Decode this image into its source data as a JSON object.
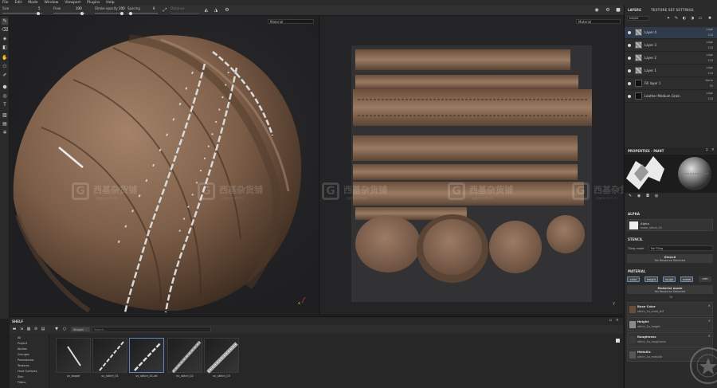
{
  "menu": [
    "File",
    "Edit",
    "Mode",
    "Window",
    "Viewport",
    "Plugins",
    "Help"
  ],
  "toolbar": {
    "size_label": "Size",
    "size_value": "5",
    "flow_label": "Flow",
    "flow_value": "100",
    "stroke_opacity_label": "Stroke opacity",
    "stroke_opacity_value": "100",
    "spacing_label": "Spacing",
    "spacing_value": "6",
    "distance_label": "Distance"
  },
  "viewport": {
    "left_dropdown": "Material",
    "right_dropdown": "Material"
  },
  "watermark": {
    "text": "西基杂货铺",
    "sub": "cgpro.com.cn"
  },
  "layers_panel": {
    "tab_layers": "LAYERS",
    "tab_texture_set": "TEXTURE SET SETTINGS",
    "channel": "height",
    "layers": [
      {
        "name": "Layer 4",
        "blend": "Ldge",
        "opacity": "100"
      },
      {
        "name": "Layer 3",
        "blend": "Ldge",
        "opacity": "100"
      },
      {
        "name": "Layer 2",
        "blend": "Ldge",
        "opacity": "100"
      },
      {
        "name": "Layer 1",
        "blend": "Ldge",
        "opacity": "100"
      },
      {
        "name": "Fill layer 1",
        "blend": "Norm",
        "opacity": "35"
      },
      {
        "name": "Leather Medium Grain",
        "blend": "Ldge",
        "opacity": "100"
      }
    ]
  },
  "properties": {
    "header": "PROPERTIES - PAINT",
    "alpha_section": "ALPHA",
    "alpha_name": "Alpha",
    "alpha_value": "mask_stitch_01",
    "stencil_section": "STENCIL",
    "tiling_label": "Tiling mode",
    "tiling_value": "No Tiling",
    "stencil_title": "Stencil",
    "stencil_value": "No Resource Selected",
    "material_section": "MATERIAL",
    "channels": [
      "color",
      "height",
      "rough",
      "metal",
      "nrm"
    ],
    "material_mode_title": "Material mode",
    "material_mode_value": "No Resource Selected",
    "or": "Or",
    "slots": [
      {
        "title": "Base Color",
        "value": "stitch_1a_color_ALT"
      },
      {
        "title": "Height",
        "value": "stitch_1a_height"
      },
      {
        "title": "Roughness",
        "value": "stitch_1a_roughness"
      },
      {
        "title": "Metallic",
        "value": "stitch_1a_metallic"
      }
    ]
  },
  "shelf": {
    "title": "SHELF",
    "filter_tag": "Shapes",
    "search_placeholder": "Search...",
    "categories": [
      "All",
      "Project",
      "Alphas",
      "Grunges",
      "Procedurals",
      "Textures",
      "Hard Surfaces",
      "Skin",
      "Filters"
    ],
    "items": [
      "vv_staple",
      "vv_stitch_01",
      "vv_stitch_01-alt",
      "vv_stitch_02",
      "vv_stitch_03"
    ]
  }
}
